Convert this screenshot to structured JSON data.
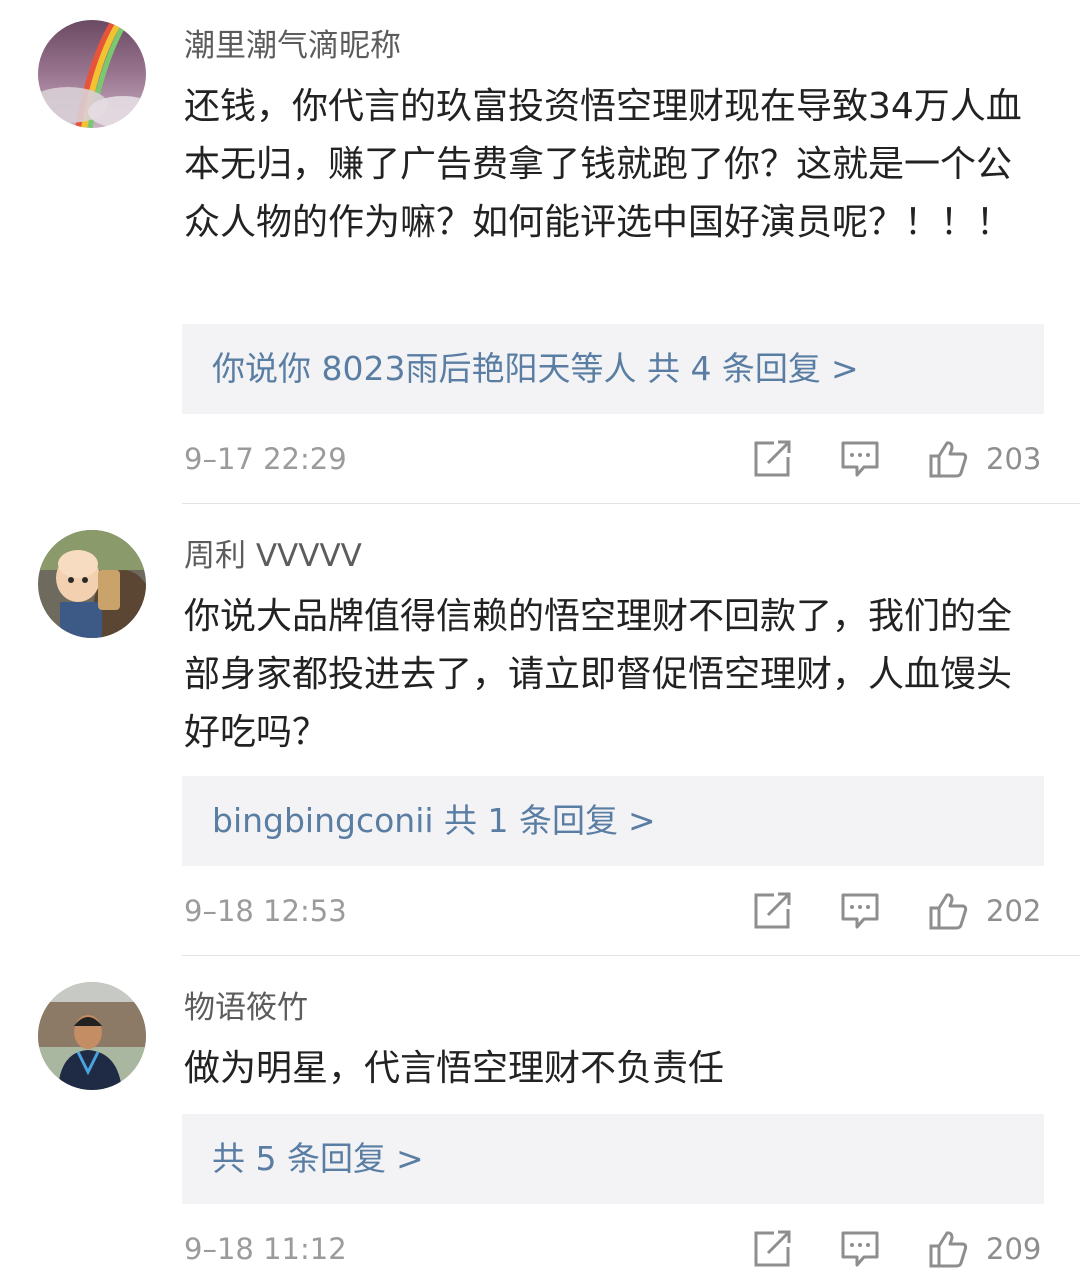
{
  "comments": [
    {
      "username": "潮里潮气滴昵称",
      "avatar_icon": "rainbow-sky-avatar",
      "text": "还钱，你代言的玖富投资悟空理财现在导致34万人血本无归，赚了广告费拿了钱就跑了你？这就是一个公众人物的作为嘛？如何能评选中国好演员呢？！！！",
      "reply_summary": "你说你 8023雨后艳阳天等人  共 4 条回复",
      "time": "9–17 22:29",
      "likes": "203"
    },
    {
      "username": "周利 VVVVV",
      "avatar_icon": "cartoon-monk-avatar",
      "text": "你说大品牌值得信赖的悟空理财不回款了，我们的全部身家都投进去了，请立即督促悟空理财，人血馒头好吃吗？",
      "reply_summary": "bingbingconii  共 1 条回复",
      "time": "9–18 12:53",
      "likes": "202"
    },
    {
      "username": "物语筱竹",
      "avatar_icon": "person-photo-avatar",
      "text": "做为明星，代言悟空理财不负责任",
      "reply_summary": "共 5 条回复",
      "time": "9–18 11:12",
      "likes": "209"
    }
  ],
  "chevron": ">",
  "icons": {
    "share": "share-icon",
    "comment": "comment-icon",
    "like": "thumbs-up-icon"
  },
  "colors": {
    "link": "#5a7ea3",
    "meta": "#9b9b9b",
    "reply_bg": "#f3f3f5"
  }
}
